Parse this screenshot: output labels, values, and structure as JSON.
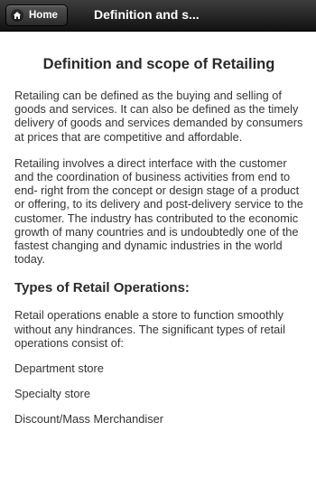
{
  "header": {
    "home_label": "Home",
    "title": "Definition and s..."
  },
  "main": {
    "title": "Definition and scope of Retailing",
    "paragraphs": [
      "Retailing can be defined as the buying and selling of goods and services. It can also be defined as the timely delivery of goods and services demanded by consumers at prices that are competitive and affordable.",
      "Retailing involves a direct interface with the customer and the coordination of business activities from end to end- right from the concept or design stage of a product or offering, to its delivery and post-delivery service to the customer. The industry has contributed to the economic growth of many countries and is undoubtedly one of the fastest changing and dynamic industries in the world today."
    ],
    "section_heading": "Types of Retail Operations:",
    "section_intro": "Retail operations enable a store to function smoothly without any hindrances. The significant types of retail operations consist of:",
    "list_items": [
      "Department store",
      "Specialty store",
      "Discount/Mass Merchandiser"
    ]
  }
}
